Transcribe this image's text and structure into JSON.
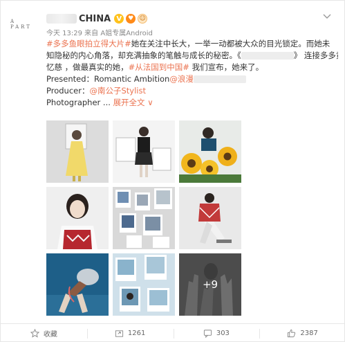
{
  "post": {
    "author_suffix": "CHINA",
    "avatar_brand": "A PART",
    "verified_label": "V",
    "meta": "今天 13:29 来自 A姐专属Android",
    "lines": {
      "l1_tag": "#多多鱼眼拍立得大片#",
      "l1_text": "她在关注中长大，一举一动都被大众的目光锁定。而她未",
      "l2_text_a": "知隐秘的内心角落，却充满抽象的笔触与成长的秘密。《",
      "l2_text_b": "》 连接多多黄",
      "l3_text_a": "忆慈 ，做最真实的她，",
      "l3_tag": "#从法国到中国#",
      "l3_text_b": " 我们宣布，她来了。",
      "l4": "Presented：Romantic Ambition",
      "l4_mention": "@浪漫",
      "l5_label": "Producer：",
      "l5_mention": "@南公子Stylist",
      "l6_label": "Photographer ... ",
      "l6_expand": "展开全文 ∨"
    },
    "more_photos": "+9"
  },
  "footer": {
    "favorite": "收藏",
    "forward": "1261",
    "comment": "303",
    "like": "2387"
  },
  "colors": {
    "accent": "#eb7350",
    "verified": "#ffc21c",
    "meta": "#8a8a8a"
  }
}
